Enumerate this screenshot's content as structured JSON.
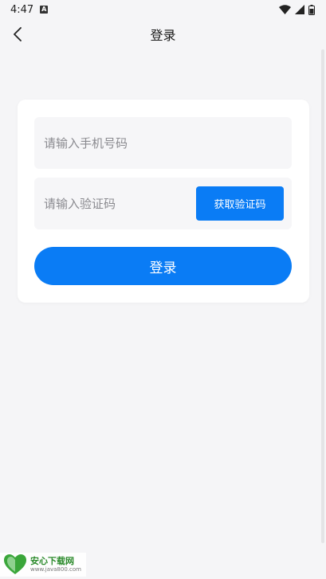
{
  "status_bar": {
    "time": "4:47",
    "notification_icon_label": "A",
    "icons": [
      "wifi-icon",
      "signal-icon",
      "battery-icon"
    ]
  },
  "nav": {
    "title": "登录",
    "back_icon": "chevron-left-icon"
  },
  "form": {
    "phone_placeholder": "请输入手机号码",
    "phone_value": "",
    "code_placeholder": "请输入验证码",
    "code_value": "",
    "get_code_label": "获取验证码",
    "login_label": "登录"
  },
  "watermark": {
    "logo_text": "安心",
    "name": "安心下载网",
    "url": "www.java800.com"
  },
  "colors": {
    "accent": "#0a7cf5",
    "background": "#f5f5f7",
    "card": "#ffffff",
    "field": "#f6f6f8"
  }
}
